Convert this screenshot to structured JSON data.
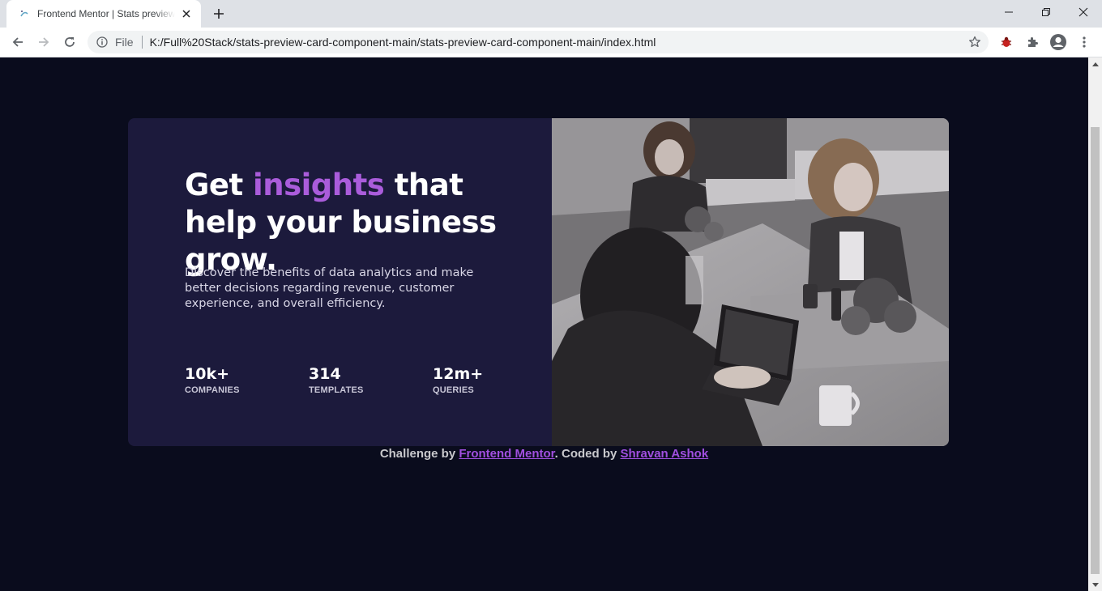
{
  "browser": {
    "tab_title": "Frontend Mentor | Stats preview card component",
    "url_scheme_label": "File",
    "url": "K:/Full%20Stack/stats-preview-card-component-main/stats-preview-card-component-main/index.html"
  },
  "card": {
    "headline_part1": "Get ",
    "headline_accent": "insights",
    "headline_part2": " that help your business grow.",
    "description": "Discover the benefits of data analytics and make better decisions regarding revenue, customer experience, and overall efficiency.",
    "stats": [
      {
        "value": "10k+",
        "label": "COMPANIES"
      },
      {
        "value": "314",
        "label": "TEMPLATES"
      },
      {
        "value": "12m+",
        "label": "QUERIES"
      }
    ]
  },
  "attribution": {
    "prefix": "Challenge by ",
    "link1": "Frontend Mentor",
    "middle": ". Coded by ",
    "link2": "Shravan Ashok"
  },
  "colors": {
    "page_bg": "#0a0c1d",
    "card_bg": "#1c1a3c",
    "accent": "#aa5cdb",
    "link": "#a14fe0"
  }
}
